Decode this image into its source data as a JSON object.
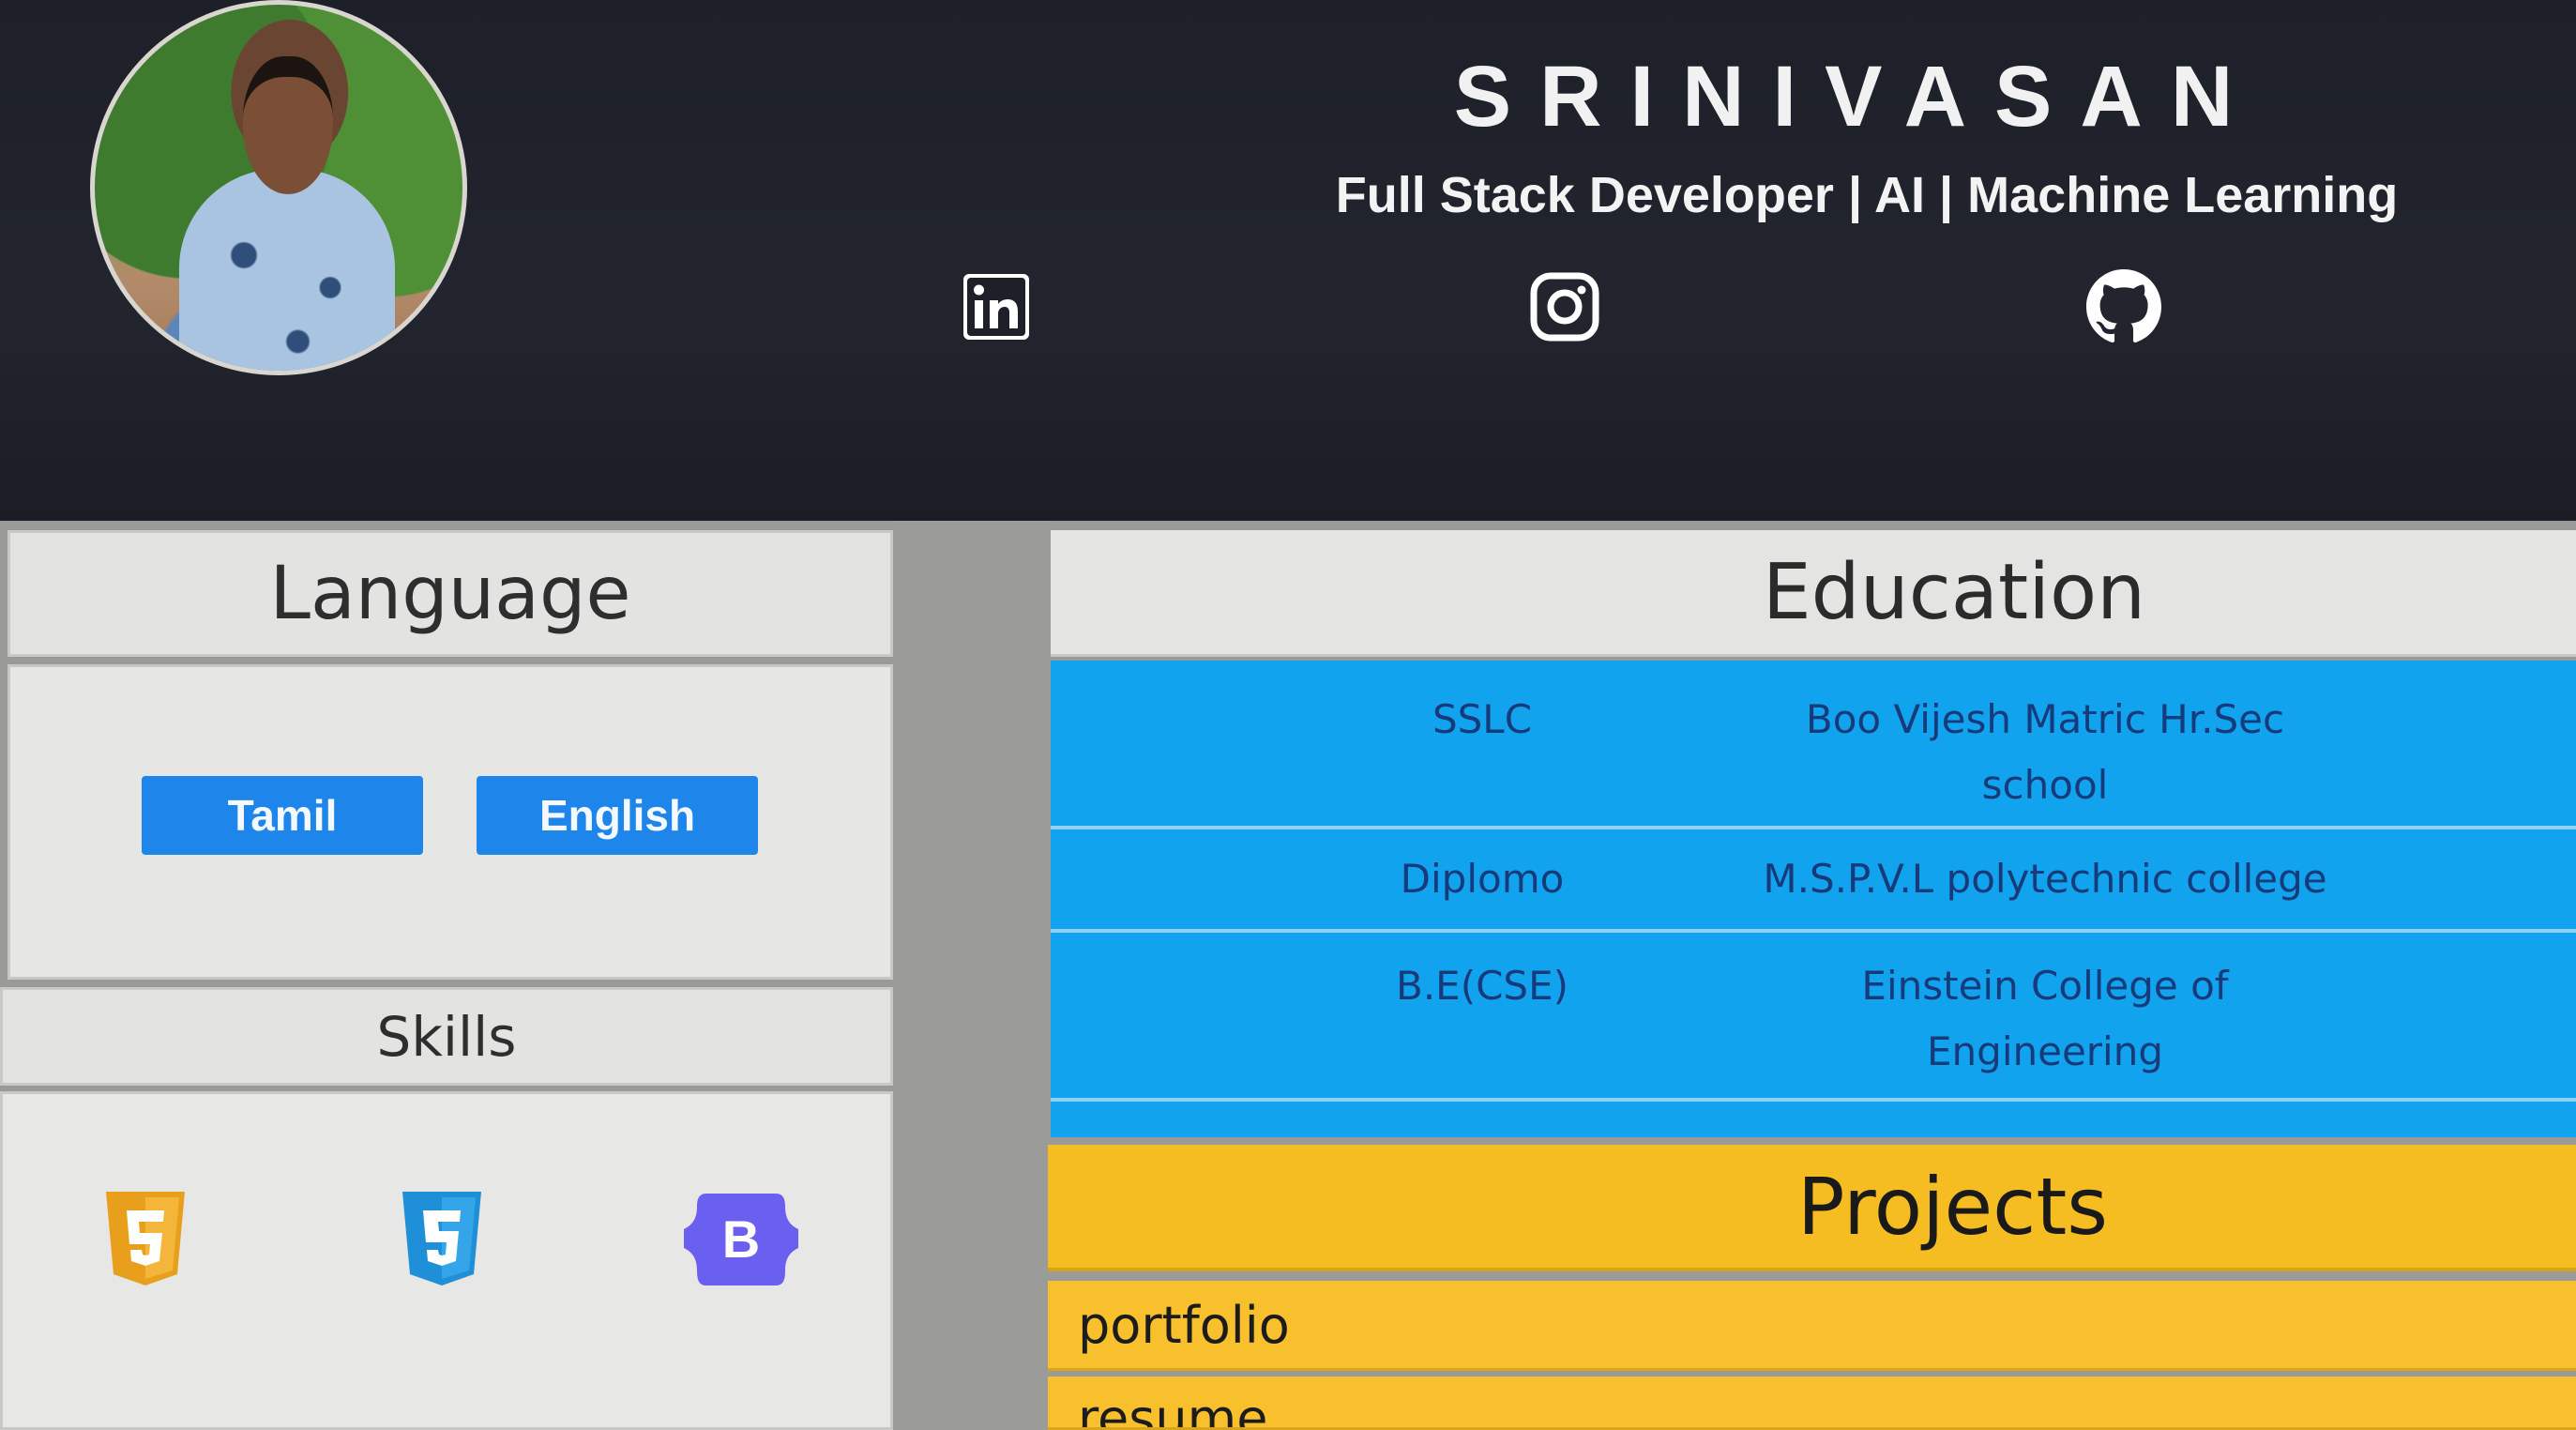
{
  "header": {
    "name": "SRINIVASAN",
    "tagline": "Full Stack Developer | AI | Machine Learning",
    "social": [
      {
        "icon": "linkedin-icon"
      },
      {
        "icon": "instagram-icon"
      },
      {
        "icon": "github-icon"
      }
    ]
  },
  "language": {
    "title": "Language",
    "items": [
      "Tamil",
      "English"
    ]
  },
  "skills": {
    "title": "Skills",
    "icons": [
      "html5-icon",
      "css3-icon",
      "bootstrap-icon"
    ]
  },
  "education": {
    "title": "Education",
    "rows": [
      {
        "level": "SSLC",
        "institution": "Boo Vijesh Matric Hr.Sec school"
      },
      {
        "level": "Diplomo",
        "institution": "M.S.P.V.L polytechnic college"
      },
      {
        "level": "B.E(CSE)",
        "institution": "Einstein College of Engineering"
      }
    ]
  },
  "projects": {
    "title": "Projects",
    "items": [
      "portfolio",
      "resume"
    ]
  },
  "colors": {
    "header_bg": "#1d2029",
    "button_blue": "#1e86ea",
    "education_blue": "#12a3ef",
    "projects_yellow": "#f6bd22",
    "html5_orange": "#e8a01c",
    "css3_blue": "#1f8fd8",
    "bootstrap_purple": "#6b5ff0"
  }
}
